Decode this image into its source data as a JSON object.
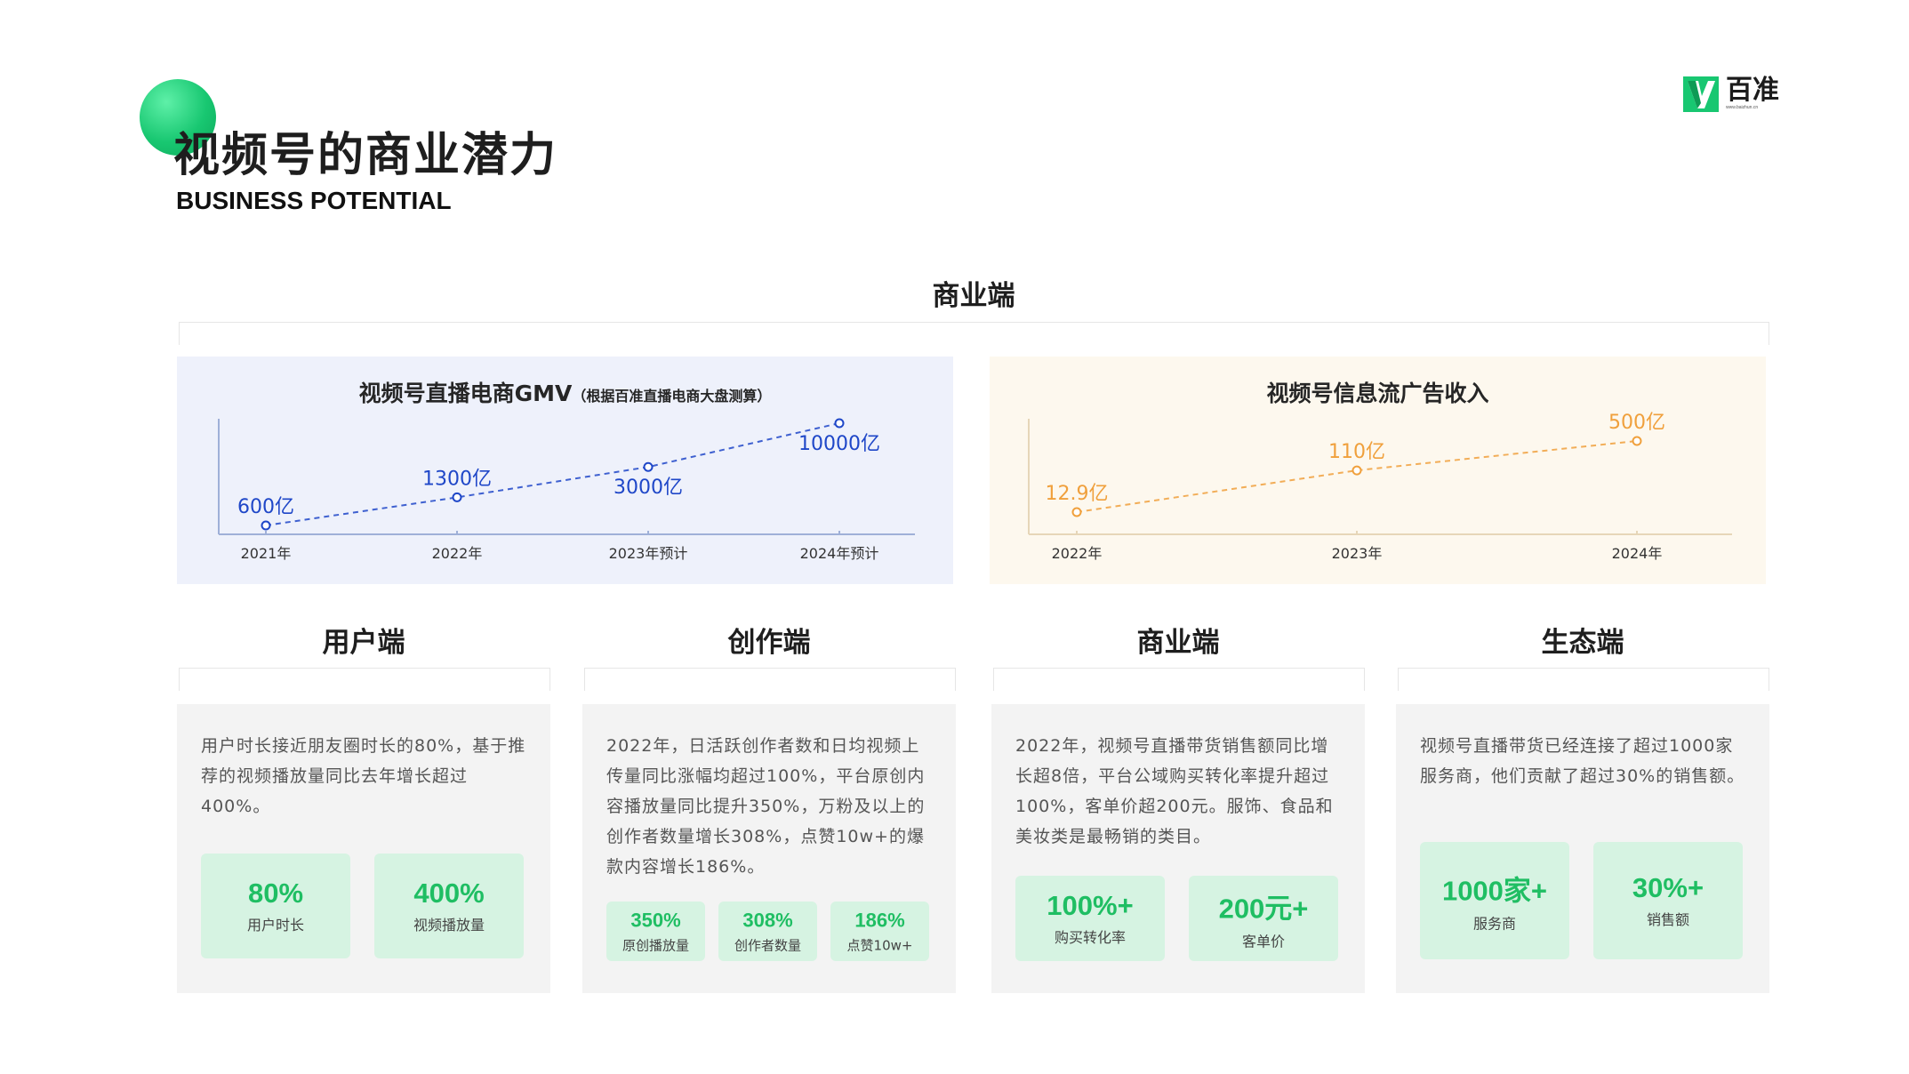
{
  "header": {
    "title": "视频号的商业潜力",
    "subtitle": "BUSINESS POTENTIAL"
  },
  "logo": {
    "name": "百准",
    "url_text": "www.baizhun.cn",
    "icon": "baizhun-logo-icon",
    "color": "#18c771"
  },
  "top_section": {
    "heading": "商业端"
  },
  "chart_data": [
    {
      "type": "line",
      "title": "视频号直播电商GMV",
      "note": "（根据百准直播电商大盘测算）",
      "categories": [
        "2021年",
        "2022年",
        "2023年预计",
        "2024年预计"
      ],
      "values": [
        600,
        1300,
        3000,
        10000
      ],
      "data_labels": [
        "600亿",
        "1300亿",
        "3000亿",
        "10000亿"
      ],
      "color": "#1f47c8"
    },
    {
      "type": "line",
      "title": "视频号信息流广告收入",
      "categories": [
        "2022年",
        "2023年",
        "2024年"
      ],
      "values": [
        12.9,
        110,
        500
      ],
      "data_labels": [
        "12.9亿",
        "110亿",
        "500亿"
      ],
      "color": "#f0a03c"
    }
  ],
  "cards": [
    {
      "heading": "用户端",
      "text": "用户时长接近朋友圈时长的80%，基于推荐的视频播放量同比去年增长超过400%。",
      "stats": [
        {
          "value": "80%",
          "label": "用户时长"
        },
        {
          "value": "400%",
          "label": "视频播放量"
        }
      ]
    },
    {
      "heading": "创作端",
      "text": "2022年，日活跃创作者数和日均视频上传量同比涨幅均超过100%，平台原创内容播放量同比提升350%，万粉及以上的创作者数量增长308%，点赞10w+的爆款内容增长186%。",
      "stats": [
        {
          "value": "350%",
          "label": "原创播放量"
        },
        {
          "value": "308%",
          "label": "创作者数量"
        },
        {
          "value": "186%",
          "label": "点赞10w+"
        }
      ]
    },
    {
      "heading": "商业端",
      "text": "2022年，视频号直播带货销售额同比增长超8倍，平台公域购买转化率提升超过100%，客单价超200元。服饰、食品和美妆类是最畅销的类目。",
      "stats": [
        {
          "value": "100%+",
          "label": "购买转化率"
        },
        {
          "value": "200元+",
          "label": "客单价"
        }
      ]
    },
    {
      "heading": "生态端",
      "text": "视频号直播带货已经连接了超过1000家服务商，他们贡献了超过30%的销售额。",
      "stats": [
        {
          "value": "1000家+",
          "label": "服务商"
        },
        {
          "value": "30%+",
          "label": "销售额"
        }
      ]
    }
  ],
  "colors": {
    "accent_green": "#1fbe63",
    "stat_bg": "#d6f3e2",
    "card_bg": "#f3f3f3",
    "blue_panel_bg": "#eef1fb",
    "orange_panel_bg": "#fdf8ee"
  }
}
